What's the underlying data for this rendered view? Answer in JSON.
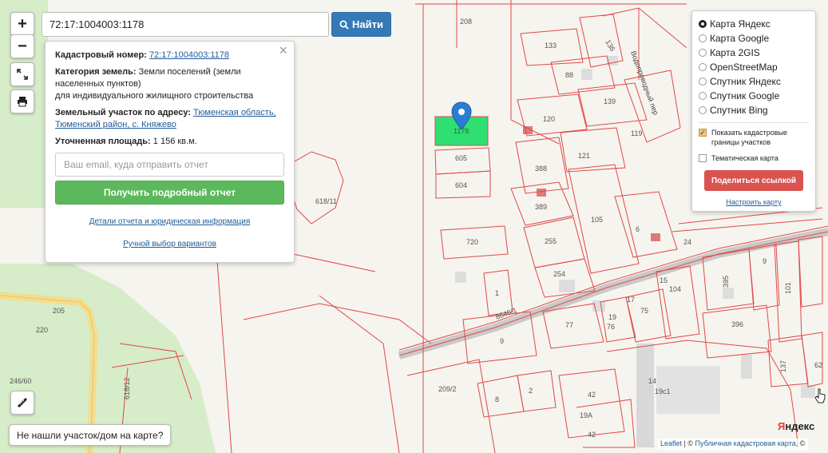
{
  "search": {
    "value": "72:17:1004003:1178",
    "button_label": "Найти"
  },
  "zoom": {
    "in_label": "+",
    "out_label": "−"
  },
  "info": {
    "cadastral_label": "Кадастровый номер:",
    "cadastral_value": "72:17:1004003:1178",
    "category_label": "Категория земель:",
    "category_value": "Земли поселений (земли населенных пунктов)",
    "category_extra": "для индивидуального жилищного строительства",
    "address_label": "Земельный участок по адресу:",
    "address_value": "Тюменская область, Тюменский район, с. Княжево",
    "area_label": "Уточненная площадь:",
    "area_value": "1 156 кв.м.",
    "email_placeholder": "Ваш email, куда отправить отчет",
    "report_button": "Получить подробный отчет",
    "details_link": "Детали отчета и юридическая информация",
    "manual_link": "Ручной выбор вариантов",
    "close": "×"
  },
  "layers": {
    "options": [
      {
        "label": "Карта Яндекс",
        "selected": true
      },
      {
        "label": "Карта Google",
        "selected": false
      },
      {
        "label": "Карта 2GIS",
        "selected": false
      },
      {
        "label": "OpenStreetMap",
        "selected": false
      },
      {
        "label": "Спутник Яндекс",
        "selected": false
      },
      {
        "label": "Спутник Google",
        "selected": false
      },
      {
        "label": "Спутник Bing",
        "selected": false
      }
    ],
    "show_borders_label": "Показать кадастровые границы участков",
    "thematic_label": "Тематическая карта",
    "share_button": "Поделиться ссылкой",
    "configure_link": "Настроить карту"
  },
  "not_found_button": "Не нашли участок/дом на карте?",
  "attribution": {
    "leaflet": "Leaflet",
    "sep": " | © ",
    "pkk": "Публичная кадастровая карта",
    "tail": ", ©"
  },
  "logo": {
    "ya": "Я",
    "ndex": "ндекс"
  },
  "map_labels": {
    "l208": "208",
    "l133": "133",
    "l136": "136",
    "l88": "88",
    "l139": "139",
    "l120": "120",
    "l119": "119",
    "l121": "121",
    "l388": "388",
    "l389": "389",
    "l105": "105",
    "l6": "6",
    "l255": "255",
    "l254": "254",
    "l24": "24",
    "l9": "9",
    "l395": "395",
    "l101": "101",
    "l15": "15",
    "l104": "104",
    "l17": "17",
    "l75": "75",
    "l77": "77",
    "l19": "19",
    "l76": "76",
    "l396": "396",
    "l1": "1",
    "l720": "720",
    "l605": "605",
    "l604": "604",
    "l1178": "1178",
    "l618_11": "618/11",
    "l205": "205",
    "l220": "220",
    "l246_60": "246/60",
    "l618_12": "618/12",
    "l209_2": "209/2",
    "l8": "8",
    "l2": "2",
    "l42": "42",
    "l42b": "42",
    "l19a": "19А",
    "l14": "14",
    "l19c1": "19с1",
    "l137": "137",
    "l62": "62",
    "l2b": "2",
    "l9b": "9",
    "l8646": "8646/1",
    "street": "Водопроводный пер"
  }
}
